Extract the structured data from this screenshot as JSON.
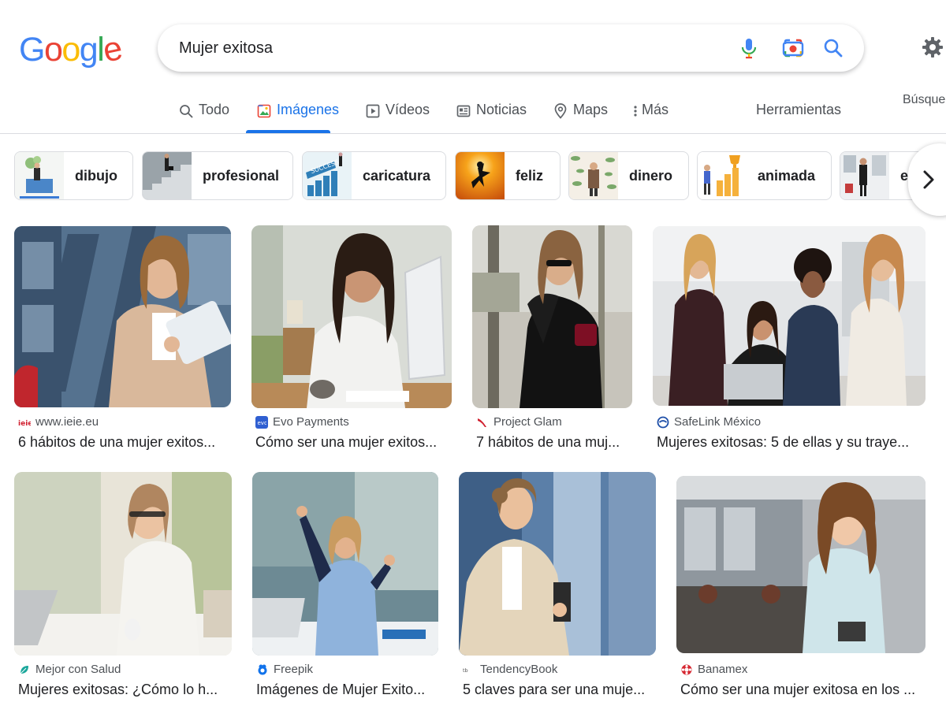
{
  "logo": {
    "letters": [
      "G",
      "o",
      "o",
      "g",
      "l",
      "e"
    ]
  },
  "search": {
    "query": "Mujer exitosa"
  },
  "colors": {
    "accent": "#1a73e8",
    "google_blue": "#4285f4",
    "google_red": "#ea4335",
    "google_yellow": "#fbbc05",
    "google_green": "#34a853"
  },
  "tabs": [
    {
      "label": "Todo",
      "icon": "search-icon"
    },
    {
      "label": "Imágenes",
      "icon": "image-icon",
      "active": true
    },
    {
      "label": "Vídeos",
      "icon": "play-icon"
    },
    {
      "label": "Noticias",
      "icon": "news-icon"
    },
    {
      "label": "Maps",
      "icon": "map-pin-icon"
    },
    {
      "label": "Más",
      "icon": "more-vert-icon"
    }
  ],
  "tools_label": "Herramientas",
  "cutoff_label": "Búsque",
  "chips": [
    {
      "label": "dibujo"
    },
    {
      "label": "profesional"
    },
    {
      "label": "caricatura"
    },
    {
      "label": "feliz"
    },
    {
      "label": "dinero"
    },
    {
      "label": "animada"
    },
    {
      "label": "el"
    }
  ],
  "results": [
    {
      "source": "www.ieie.eu",
      "title": "6 hábitos de una mujer exitos...",
      "favicon": "ieie-icon"
    },
    {
      "source": "Evo Payments",
      "title": "Cómo ser una mujer exitos...",
      "favicon": "evo-icon"
    },
    {
      "source": "Project Glam",
      "title": "7 hábitos de una muj...",
      "favicon": "heel-icon"
    },
    {
      "source": "SafeLink México",
      "title": "Mujeres exitosas: 5 de ellas y su traye...",
      "favicon": "safelink-icon"
    },
    {
      "source": "Mejor con Salud",
      "title": "Mujeres exitosas: ¿Cómo lo h...",
      "favicon": "leaf-icon"
    },
    {
      "source": "Freepik",
      "title": "Imágenes de Mujer Exito...",
      "favicon": "freepik-icon"
    },
    {
      "source": "TendencyBook",
      "title": "5 claves para ser una muje...",
      "favicon": "tendency-icon"
    },
    {
      "source": "Banamex",
      "title": "Cómo ser una mujer exitosa en los ...",
      "favicon": "banamex-icon"
    }
  ]
}
